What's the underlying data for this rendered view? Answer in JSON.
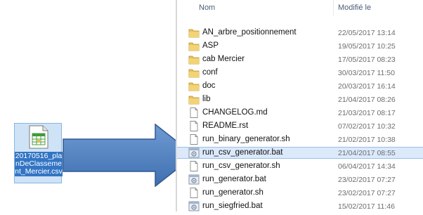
{
  "colors": {
    "header_text": "#4b5d78",
    "selection_bg": "#dbe9fb",
    "selection_border": "#9bbfe8",
    "folder": "#e8c15a",
    "arrow_fill": "#4f7fbf",
    "desktop_label_bg": "#3375c4"
  },
  "explorer": {
    "columns": {
      "name": "Nom",
      "modified": "Modifié le"
    },
    "files": [
      {
        "name": "AN_arbre_positionnement",
        "date": "22/05/2017 13:14",
        "icon": "folder-icon"
      },
      {
        "name": "ASP",
        "date": "19/05/2017 10:25",
        "icon": "folder-icon"
      },
      {
        "name": "cab Mercier",
        "date": "17/05/2017 08:23",
        "icon": "folder-icon"
      },
      {
        "name": "conf",
        "date": "30/03/2017 11:50",
        "icon": "folder-icon"
      },
      {
        "name": "doc",
        "date": "20/03/2017 16:14",
        "icon": "folder-icon"
      },
      {
        "name": "lib",
        "date": "21/04/2017 08:26",
        "icon": "folder-icon"
      },
      {
        "name": "CHANGELOG.md",
        "date": "21/03/2017 08:17",
        "icon": "document-icon"
      },
      {
        "name": "README.rst",
        "date": "07/02/2017 10:32",
        "icon": "document-icon"
      },
      {
        "name": "run_binary_generator.sh",
        "date": "21/02/2017 10:38",
        "icon": "document-icon"
      },
      {
        "name": "run_csv_generator.bat",
        "date": "21/04/2017 08:55",
        "icon": "batch-file-icon",
        "selected": true
      },
      {
        "name": "run_csv_generator.sh",
        "date": "06/04/2017 14:34",
        "icon": "document-icon"
      },
      {
        "name": "run_generator.bat",
        "date": "23/02/2017 07:27",
        "icon": "batch-file-icon"
      },
      {
        "name": "run_generator.sh",
        "date": "23/02/2017 07:27",
        "icon": "document-icon"
      },
      {
        "name": "run_siegfried.bat",
        "date": "15/02/2017 11:46",
        "icon": "batch-file-icon"
      }
    ]
  },
  "desktop_file": {
    "label": "20170516_planDeClassement_Mercier.csv",
    "icon": "spreadsheet-icon"
  },
  "arrow": {
    "icon": "right-arrow-icon"
  }
}
